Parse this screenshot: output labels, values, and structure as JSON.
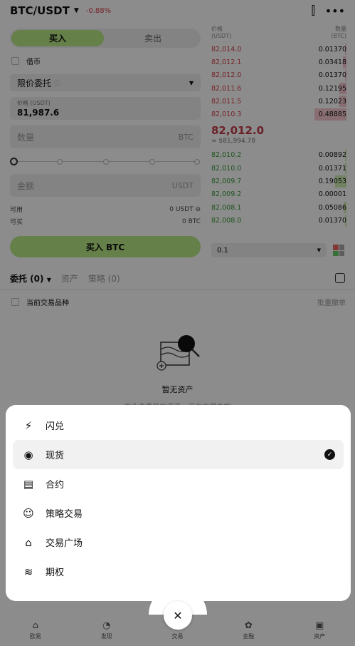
{
  "header": {
    "pair": "BTC/USDT",
    "change": "-0.88%"
  },
  "trade": {
    "buy_tab": "买入",
    "sell_tab": "卖出",
    "margin_label": "借币",
    "order_type": "限价委托",
    "price_label": "价格 (USDT)",
    "price_value": "81,987.6",
    "qty_placeholder": "数量",
    "qty_unit": "BTC",
    "amount_placeholder": "金额",
    "amount_unit": "USDT",
    "available_label": "可用",
    "available_value": "0 USDT",
    "buyable_label": "可买",
    "buyable_value": "0 BTC",
    "buy_button": "买入 BTC"
  },
  "orderbook": {
    "price_header": "价格",
    "price_unit": "(USDT)",
    "qty_header": "数量",
    "qty_unit": "(BTC)",
    "asks": [
      {
        "price": "82,014.0",
        "qty": "0.01370",
        "depth": 0.05
      },
      {
        "price": "82,012.1",
        "qty": "0.03418",
        "depth": 0.12
      },
      {
        "price": "82,012.0",
        "qty": "0.01370",
        "depth": 0.05
      },
      {
        "price": "82,011.6",
        "qty": "0.12195",
        "depth": 0.23
      },
      {
        "price": "82,011.5",
        "qty": "0.12023",
        "depth": 0.23
      },
      {
        "price": "82,010.3",
        "qty": "0.48885",
        "depth": 1.0
      }
    ],
    "mid_price": "82,012.0",
    "mid_usd": "≈ $81,994.78",
    "bids": [
      {
        "price": "82,010.2",
        "qty": "0.00892",
        "depth": 0.04
      },
      {
        "price": "82,010.0",
        "qty": "0.01371",
        "depth": 0.05
      },
      {
        "price": "82,009.7",
        "qty": "0.19053",
        "depth": 0.36
      },
      {
        "price": "82,009.2",
        "qty": "0.00001",
        "depth": 0.0
      },
      {
        "price": "82,008.1",
        "qty": "0.05086",
        "depth": 0.1
      },
      {
        "price": "82,008.0",
        "qty": "0.01370",
        "depth": 0.05
      }
    ],
    "depth_value": "0.1"
  },
  "orders": {
    "tab_orders": "委托 (0)",
    "tab_assets": "资产",
    "tab_strategy": "策略 (0)",
    "current_pair_label": "当前交易品种",
    "batch_cancel": "批量撤单",
    "empty_title": "暂无资产",
    "empty_sub": "在此查看您的资产，开启交易之旅"
  },
  "menu": [
    {
      "label": "闪兑",
      "icon": "⚡",
      "name": "flash-swap"
    },
    {
      "label": "现货",
      "icon": "◉",
      "name": "spot",
      "selected": true
    },
    {
      "label": "合约",
      "icon": "▤",
      "name": "futures"
    },
    {
      "label": "策略交易",
      "icon": "☺",
      "name": "strategy-trading"
    },
    {
      "label": "交易广场",
      "icon": "⌂",
      "name": "trading-plaza"
    },
    {
      "label": "期权",
      "icon": "≋",
      "name": "options"
    }
  ],
  "bottom_nav": [
    {
      "label": "欧易",
      "icon": "⌂"
    },
    {
      "label": "发现",
      "icon": "◔"
    },
    {
      "label": "交易",
      "icon": "⇅"
    },
    {
      "label": "金融",
      "icon": "✿"
    },
    {
      "label": "资产",
      "icon": "▣"
    }
  ]
}
